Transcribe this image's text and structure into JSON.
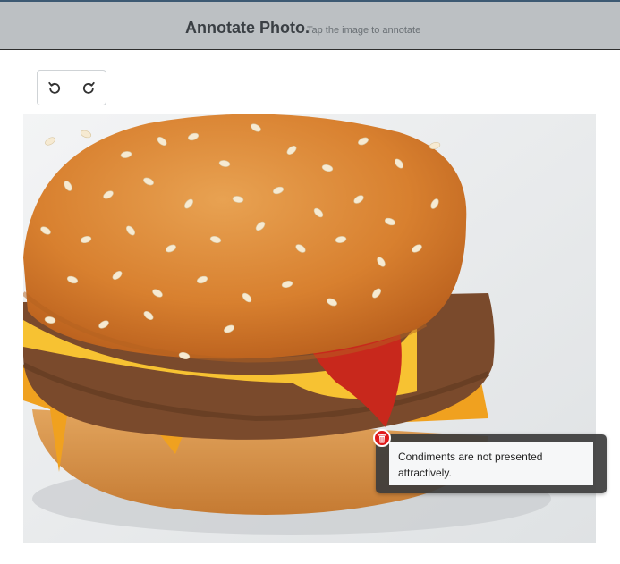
{
  "header": {
    "title": "Annotate Photo.",
    "hint": "Tap the image to annotate"
  },
  "toolbar": {
    "undo_icon": "undo-icon",
    "redo_icon": "redo-icon"
  },
  "photo": {
    "subject": "cheeseburger with sesame seed bun"
  },
  "annotation": {
    "marker_icon": "trash-icon",
    "marker_color": "#e01b1b",
    "text": "Condiments are not presented attractively."
  }
}
